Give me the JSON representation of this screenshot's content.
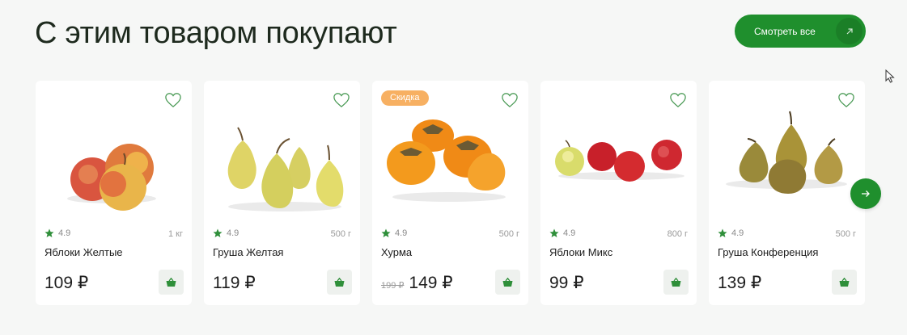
{
  "header": {
    "title": "С этим товаром покупают",
    "see_all_label": "Смотреть все"
  },
  "accent_color": "#1f8f2d",
  "badge_color": "#f7b062",
  "products": [
    {
      "name": "Яблоки Желтые",
      "rating": "4.9",
      "weight": "1 кг",
      "price": "109 ₽",
      "old_price": "",
      "badge": "",
      "image": "yellow-apples"
    },
    {
      "name": "Груша Желтая",
      "rating": "4.9",
      "weight": "500 г",
      "price": "119 ₽",
      "old_price": "",
      "badge": "",
      "image": "yellow-pears"
    },
    {
      "name": "Хурма",
      "rating": "4.9",
      "weight": "500 г",
      "price": "149 ₽",
      "old_price": "199 ₽",
      "badge": "Скидка",
      "image": "persimmon"
    },
    {
      "name": "Яблоки Микс",
      "rating": "4.9",
      "weight": "800 г",
      "price": "99 ₽",
      "old_price": "",
      "badge": "",
      "image": "mixed-apples"
    },
    {
      "name": "Груша Конференция",
      "rating": "4.9",
      "weight": "500 г",
      "price": "139 ₽",
      "old_price": "",
      "badge": "",
      "image": "conference-pears"
    }
  ]
}
